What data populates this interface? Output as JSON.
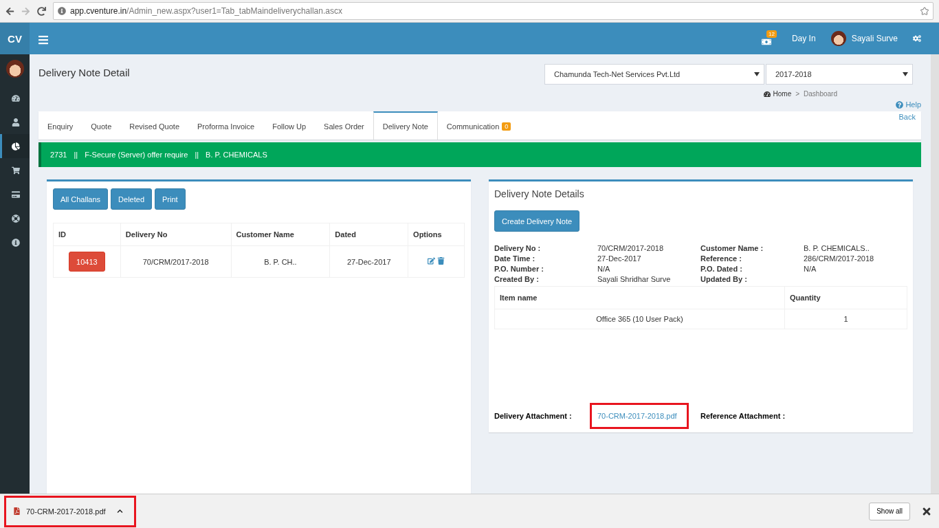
{
  "browser": {
    "url_host": "app.cventure.in",
    "url_path": "/Admin_new.aspx?user1=Tab_tabMaindeliverychallan.ascx"
  },
  "header": {
    "logo": "CV",
    "notification_count": "12",
    "day_in": "Day In",
    "user_name": "Sayali Surve"
  },
  "sidebar": {
    "items": [
      {
        "selected": false
      },
      {
        "selected": false
      },
      {
        "selected": true
      },
      {
        "selected": false
      },
      {
        "selected": false
      },
      {
        "selected": false
      },
      {
        "selected": false
      }
    ]
  },
  "page": {
    "title": "Delivery Note Detail",
    "company_select": "Chamunda Tech-Net Services Pvt.Ltd",
    "year_select": "2017-2018",
    "breadcrumb": [
      "Home",
      "Dashboard"
    ],
    "breadcrumb_separator": ">",
    "help": "Help"
  },
  "tabs": [
    {
      "label": "Enquiry",
      "selected": false
    },
    {
      "label": "Quote",
      "selected": false
    },
    {
      "label": "Revised Quote",
      "selected": false
    },
    {
      "label": "Proforma Invoice",
      "selected": false
    },
    {
      "label": "Follow Up",
      "selected": false
    },
    {
      "label": "Sales Order",
      "selected": false
    },
    {
      "label": "Delivery Note",
      "selected": true
    },
    {
      "label": "Communication",
      "selected": false,
      "badge": "0"
    }
  ],
  "back_link": "Back",
  "banner": {
    "parts": [
      "2731",
      "F-Secure (Server) offer require",
      "B. P. CHEMICALS"
    ],
    "separator": "||"
  },
  "left_panel": {
    "buttons": [
      "All Challans",
      "Deleted",
      "Print"
    ],
    "table": {
      "columns": [
        "ID",
        "Delivery No",
        "Customer Name",
        "Dated",
        "Options"
      ],
      "rows": [
        {
          "id": "10413",
          "delivery_no": "70/CRM/2017-2018",
          "customer_name": "B. P. CH..",
          "dated": "27-Dec-2017"
        }
      ]
    }
  },
  "right_panel": {
    "title": "Delivery Note Details",
    "create_button": "Create Delivery Note",
    "fields": [
      {
        "label": "Delivery No :",
        "value": "70/CRM/2017-2018"
      },
      {
        "label": "Customer Name :",
        "value": "B. P. CHEMICALS.."
      },
      {
        "label": "Date Time :",
        "value": "27-Dec-2017"
      },
      {
        "label": "Reference :",
        "value": "286/CRM/2017-2018"
      },
      {
        "label": "P.O. Number :",
        "value": "N/A"
      },
      {
        "label": "P.O. Dated :",
        "value": "N/A"
      },
      {
        "label": "Created By :",
        "value": "Sayali Shridhar Surve"
      },
      {
        "label": "Updated By :"
      }
    ],
    "items_table": {
      "columns": [
        "Item name",
        "Quantity"
      ],
      "rows": [
        {
          "item_name": "Office 365 (10 User Pack)",
          "quantity": "1"
        }
      ]
    },
    "delivery_attachment": {
      "label": "Delivery Attachment :",
      "file": "70-CRM-2017-2018.pdf",
      "highlighted": true
    },
    "reference_attachment": {
      "label": "Reference Attachment :"
    }
  },
  "download_bar": {
    "file": "70-CRM-2017-2018.pdf",
    "highlighted": true,
    "show_all": "Show all"
  }
}
